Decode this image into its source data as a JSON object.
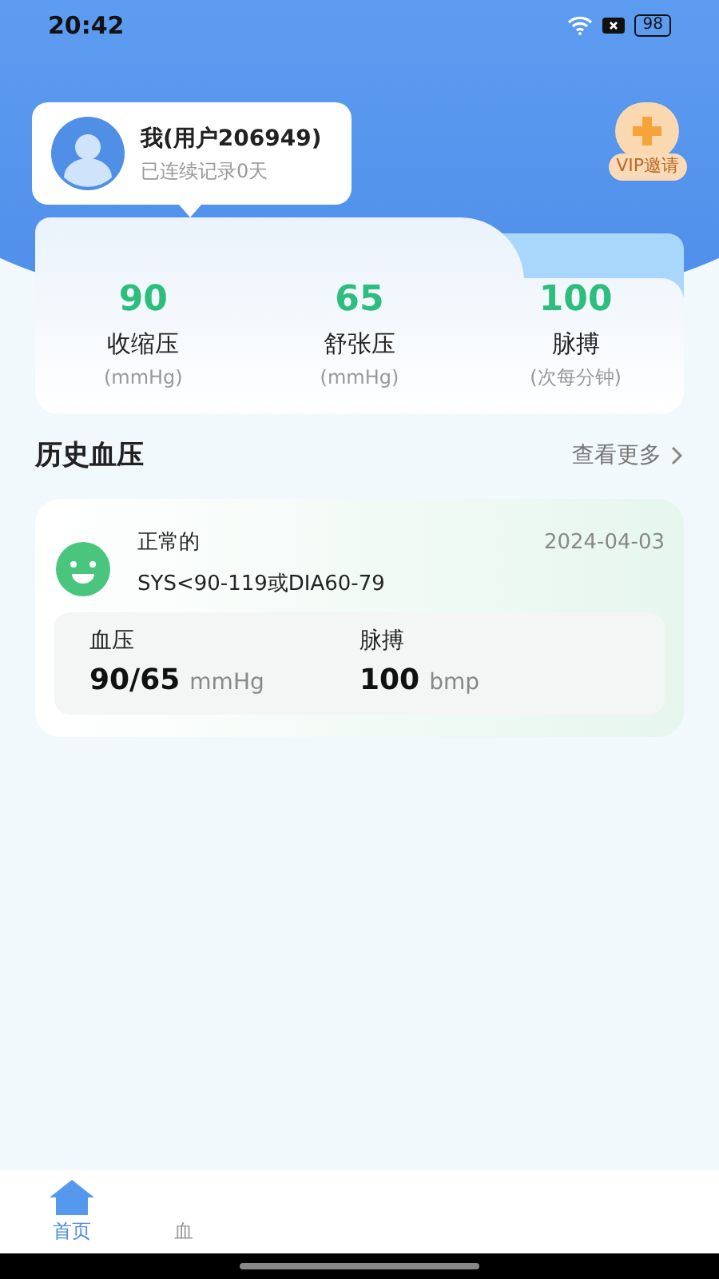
{
  "status_bar": {
    "time": "20:42",
    "battery": "98"
  },
  "profile": {
    "name": "我(用户206949)",
    "subtitle": "已连续记录0天"
  },
  "vip": {
    "label": "VIP邀请"
  },
  "stats": [
    {
      "value": "90",
      "label": "收缩压",
      "unit": "(mmHg)"
    },
    {
      "value": "65",
      "label": "舒张压",
      "unit": "(mmHg)"
    },
    {
      "value": "100",
      "label": "脉搏",
      "unit": "(次每分钟)"
    }
  ],
  "history": {
    "title": "历史血压",
    "more": "查看更多"
  },
  "records": [
    {
      "status": "正常的",
      "range": "SYS<90-119或DIA60-79",
      "date": "2024-04-03",
      "bp_label": "血压",
      "bp_value": "90/65",
      "bp_unit": "mmHg",
      "pulse_label": "脉搏",
      "pulse_value": "100",
      "pulse_unit": "bmp"
    }
  ],
  "nav": [
    {
      "label": "首页",
      "selected": true
    },
    {
      "label": "血",
      "selected": false
    }
  ]
}
